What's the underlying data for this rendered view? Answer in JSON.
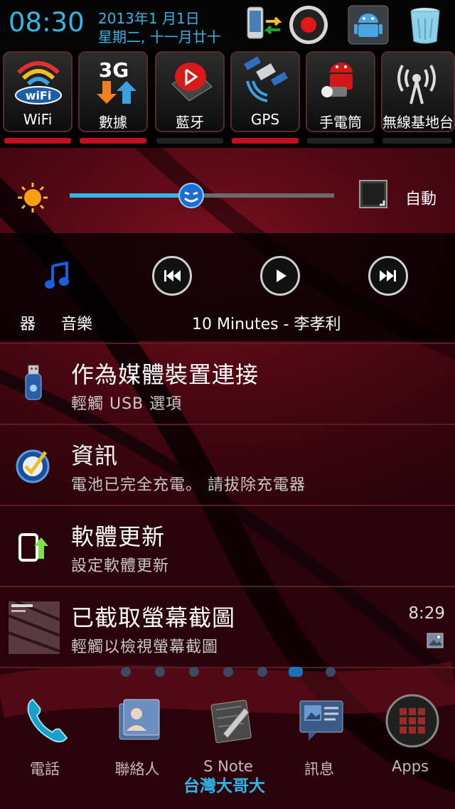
{
  "statusbar": {
    "time": "08:30",
    "date": "2013年1 月1日",
    "weekday_lunar": "星期二, 十一月廿十"
  },
  "toggles": [
    {
      "label": "WiFi",
      "icon": "wifi-icon",
      "active": true
    },
    {
      "label": "數據",
      "icon": "mobile-data-3g-icon",
      "active": true
    },
    {
      "label": "藍牙",
      "icon": "bluetooth-icon",
      "active": false
    },
    {
      "label": "GPS",
      "icon": "gps-satellite-icon",
      "active": true
    },
    {
      "label": "手電筒",
      "icon": "flashlight-icon",
      "active": false
    },
    {
      "label": "無線基地台",
      "icon": "wireless-hotspot-icon",
      "active": false
    }
  ],
  "brightness": {
    "level": 0.46,
    "auto_label": "自動"
  },
  "music": {
    "prefix": "器",
    "app": "音樂",
    "track": "10 Minutes - 李孝利"
  },
  "notifications": [
    {
      "title": "作為媒體裝置連接",
      "subtitle": "輕觸 USB 選項",
      "icon": "usb-icon",
      "time": ""
    },
    {
      "title": "資訊",
      "subtitle": "電池已完全充電。 請拔除充電器",
      "icon": "info-check-icon",
      "time": ""
    },
    {
      "title": "軟體更新",
      "subtitle": "設定軟體更新",
      "icon": "software-update-icon",
      "time": ""
    },
    {
      "title": "已截取螢幕截圖",
      "subtitle": "輕觸以檢視螢幕截圖",
      "icon": "screenshot-thumbnail",
      "time": "8:29"
    }
  ],
  "dock": [
    {
      "label": "電話",
      "icon": "phone-icon"
    },
    {
      "label": "聯絡人",
      "icon": "contacts-icon"
    },
    {
      "label": "S Note",
      "icon": "snote-icon"
    },
    {
      "label": "訊息",
      "icon": "messages-icon"
    },
    {
      "label": "Apps",
      "icon": "apps-icon"
    }
  ],
  "watermark": "台灣大哥大",
  "colors": {
    "accent": "#33b5e5",
    "toggle_on": "#c4101c",
    "background": "#4a0712"
  }
}
